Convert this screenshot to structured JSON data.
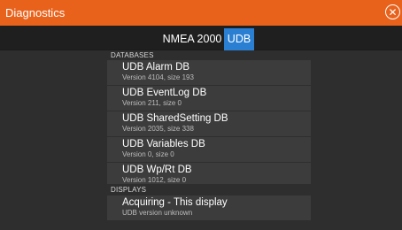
{
  "window": {
    "title": "Diagnostics",
    "close_icon": "close-icon"
  },
  "tabs": [
    {
      "label": "NMEA 2000",
      "selected": false
    },
    {
      "label": "UDB",
      "selected": true
    }
  ],
  "colors": {
    "titlebar": "#e8621c",
    "tab_selected": "#2a7fd2"
  },
  "databases": {
    "header": "DATABASES",
    "items": [
      {
        "name": "UDB Alarm DB",
        "detail": "Version  4104, size 193"
      },
      {
        "name": "UDB EventLog DB",
        "detail": "Version  211, size 0"
      },
      {
        "name": "UDB SharedSetting DB",
        "detail": "Version  2035, size 338"
      },
      {
        "name": "UDB Variables DB",
        "detail": "Version  0, size 0"
      },
      {
        "name": "UDB Wp/Rt DB",
        "detail": "Version  1012, size 0"
      }
    ]
  },
  "displays": {
    "header": "DISPLAYS",
    "items": [
      {
        "name": "Acquiring  -  This display",
        "detail": "UDB version unknown"
      }
    ]
  }
}
